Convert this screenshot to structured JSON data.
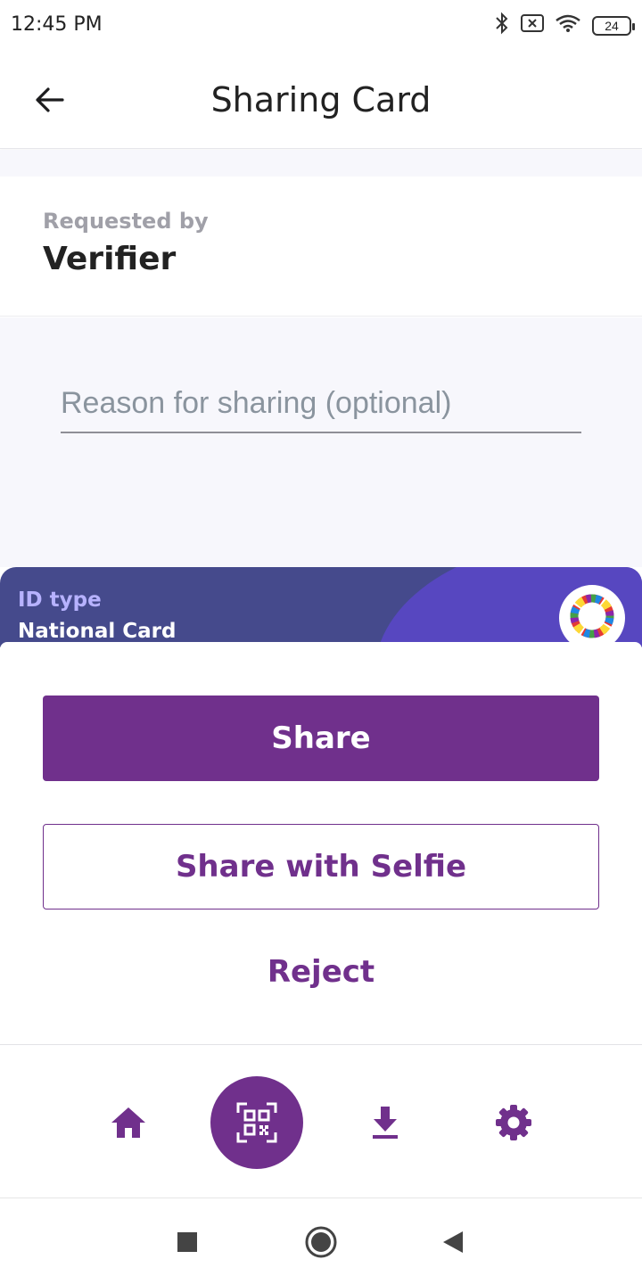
{
  "status_bar": {
    "time": "12:45 PM",
    "battery": "24",
    "icons": [
      "bluetooth-icon",
      "sim-off-icon",
      "wifi-icon",
      "battery-icon"
    ]
  },
  "header": {
    "title": "Sharing Card",
    "back_icon": "arrow-left-icon"
  },
  "requester": {
    "label": "Requested by",
    "name": "Verifier"
  },
  "reason": {
    "placeholder": "Reason for sharing (optional)",
    "value": ""
  },
  "card": {
    "id_type_label": "ID type",
    "id_type_value": "National Card",
    "logo": "MOSIP"
  },
  "actions": {
    "share": "Share",
    "share_with_selfie": "Share with Selfie",
    "reject": "Reject"
  },
  "tabs": [
    {
      "icon": "home-icon",
      "active": false
    },
    {
      "icon": "qr-scan-icon",
      "active": true
    },
    {
      "icon": "download-icon",
      "active": false
    },
    {
      "icon": "gear-icon",
      "active": false
    }
  ],
  "nav": [
    "recents-square-icon",
    "home-circle-icon",
    "back-triangle-icon"
  ],
  "colors": {
    "primary": "#70308c",
    "card_bg": "#454a8c",
    "card_accent": "#5747c0",
    "surface_tint": "#f7f7fc"
  }
}
